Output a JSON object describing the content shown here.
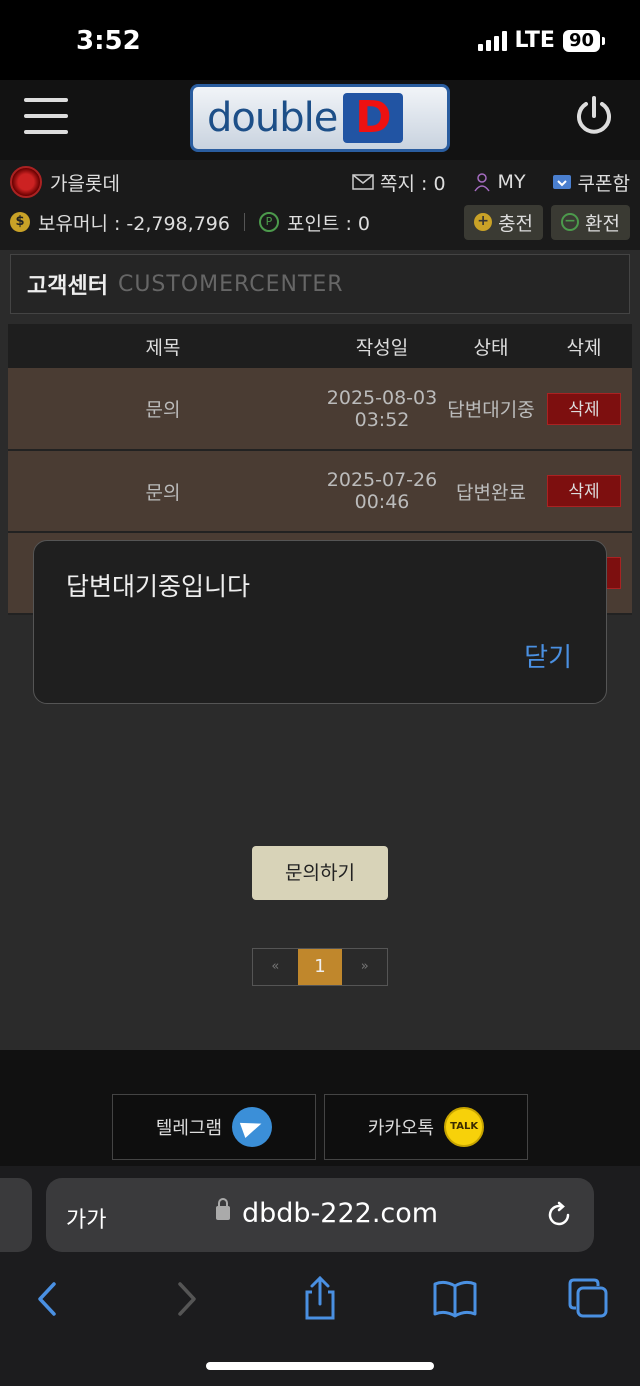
{
  "status_bar": {
    "time": "3:52",
    "network": "LTE",
    "battery": "90"
  },
  "header": {
    "logo_word": "double",
    "logo_letter": "D"
  },
  "user_bar": {
    "username": "가을롯데",
    "mail_label": "쪽지 : 0",
    "my_label": "MY",
    "coupon_label": "쿠폰함",
    "money_label": "보유머니 : -2,798,796",
    "point_label": "포인트 : 0",
    "charge_label": "충전",
    "exchange_label": "환전"
  },
  "page": {
    "title_ko": "고객센터",
    "title_en": "CUSTOMERCENTER"
  },
  "table": {
    "headers": [
      "제목",
      "작성일",
      "상태",
      "삭제"
    ],
    "rows": [
      {
        "title": "문의",
        "date": "2025-08-03",
        "time": "03:52",
        "status": "답변대기중",
        "delete": "삭제"
      },
      {
        "title": "문의",
        "date": "2025-07-26",
        "time": "00:46",
        "status": "답변완료",
        "delete": "삭제"
      }
    ]
  },
  "modal": {
    "message": "답변대기중입니다",
    "close_label": "닫기"
  },
  "ask_button": "문의하기",
  "pagination": {
    "prev": "«",
    "current": "1",
    "next": "»"
  },
  "footer": {
    "telegram_label": "텔레그램",
    "kakao_label": "카카오톡",
    "kakao_badge": "TALK"
  },
  "browser": {
    "aa_label": "가가",
    "url": "dbdb-222.com"
  }
}
